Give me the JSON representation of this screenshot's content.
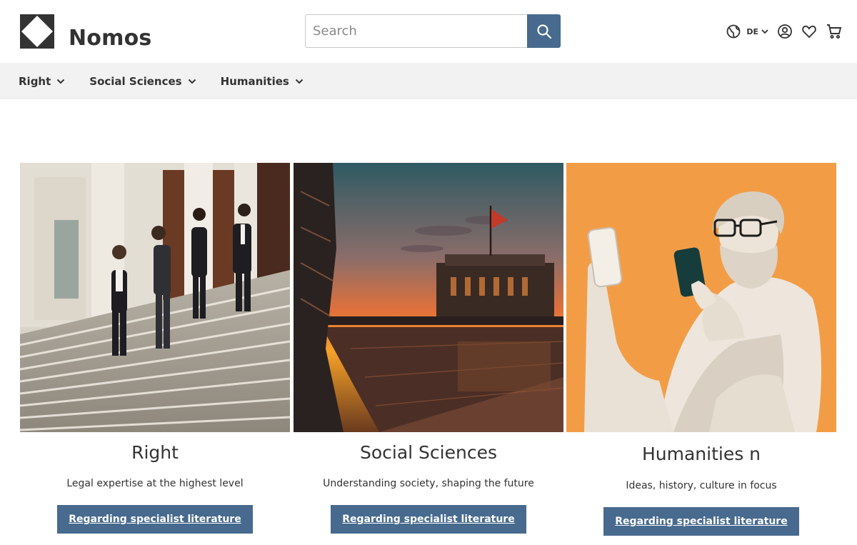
{
  "header": {
    "brand": "Nomos",
    "search": {
      "placeholder": "Search",
      "value": ""
    },
    "language": "DE"
  },
  "nav": {
    "items": [
      {
        "label": "Right"
      },
      {
        "label": "Social Sciences"
      },
      {
        "label": "Humanities"
      }
    ]
  },
  "cards": [
    {
      "title": "Right",
      "subtitle": "Legal expertise at the highest level",
      "button": "Regarding specialist literature"
    },
    {
      "title": "Social Sciences",
      "subtitle": "Understanding society, shaping the future",
      "button": "Regarding specialist literature"
    },
    {
      "title": "Humanities n",
      "subtitle": "Ideas, history, culture in focus",
      "button": "Regarding specialist literature"
    }
  ],
  "colors": {
    "accent": "#476a8e",
    "nav_bg": "#f2f2f2",
    "text": "#333333"
  }
}
